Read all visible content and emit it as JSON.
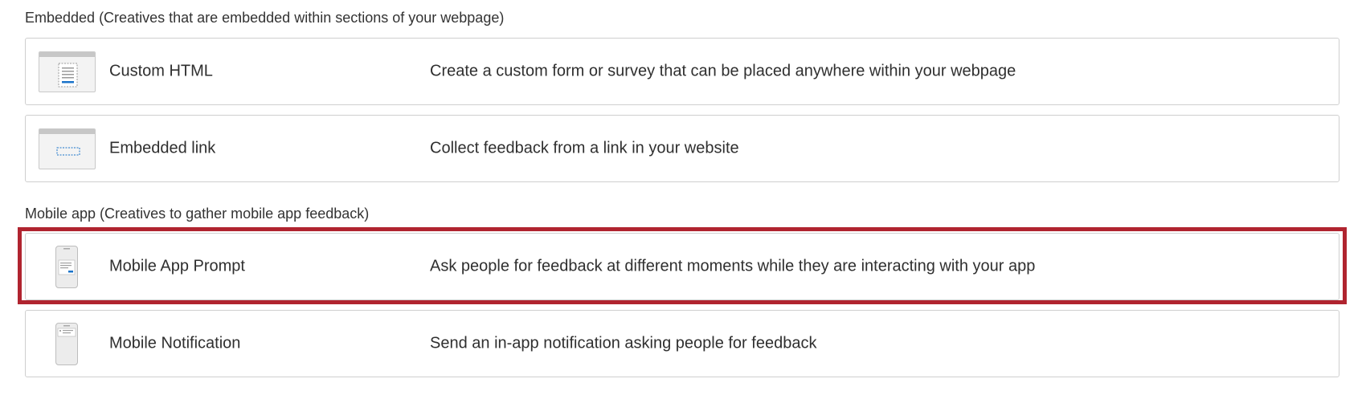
{
  "sections": {
    "embedded": {
      "label": "Embedded (Creatives that are embedded within sections of your webpage)",
      "items": [
        {
          "name": "Custom HTML",
          "description": "Create a custom form or survey that can be placed anywhere within your webpage",
          "icon": "custom-html-browser-icon"
        },
        {
          "name": "Embedded link",
          "description": "Collect feedback from a link in your website",
          "icon": "embedded-link-browser-icon"
        }
      ]
    },
    "mobile": {
      "label": "Mobile app (Creatives to gather mobile app feedback)",
      "items": [
        {
          "name": "Mobile App Prompt",
          "description": "Ask people for feedback at different moments while they are interacting with your app",
          "icon": "mobile-prompt-phone-icon",
          "highlighted": true
        },
        {
          "name": "Mobile Notification",
          "description": "Send an in-app notification asking people for feedback",
          "icon": "mobile-notification-phone-icon"
        }
      ]
    }
  },
  "colors": {
    "highlight": "#b0242f",
    "accent_blue": "#1a73c9",
    "border": "#cfcfcf"
  }
}
